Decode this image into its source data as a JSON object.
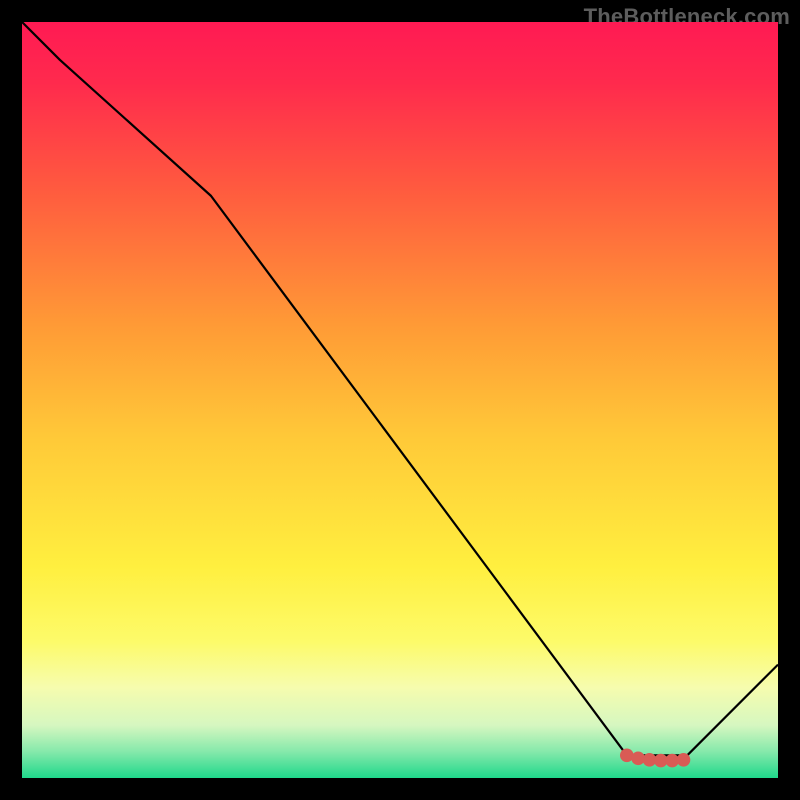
{
  "watermark": "TheBottleneck.com",
  "chart_data": {
    "type": "line",
    "title": "",
    "xlabel": "",
    "ylabel": "",
    "xlim": [
      0,
      100
    ],
    "ylim": [
      0,
      100
    ],
    "grid": false,
    "legend": false,
    "gradient_stops": [
      {
        "offset": 0.0,
        "color": "#ff1a53"
      },
      {
        "offset": 0.08,
        "color": "#ff2a4d"
      },
      {
        "offset": 0.22,
        "color": "#ff5a3f"
      },
      {
        "offset": 0.4,
        "color": "#ff9a36"
      },
      {
        "offset": 0.55,
        "color": "#ffc938"
      },
      {
        "offset": 0.72,
        "color": "#ffef3f"
      },
      {
        "offset": 0.82,
        "color": "#fdfb6a"
      },
      {
        "offset": 0.88,
        "color": "#f6fcae"
      },
      {
        "offset": 0.93,
        "color": "#d6f7c0"
      },
      {
        "offset": 0.965,
        "color": "#86e9ab"
      },
      {
        "offset": 1.0,
        "color": "#1fd88b"
      }
    ],
    "series": [
      {
        "name": "bottleneck-curve",
        "color": "#000000",
        "x": [
          0,
          5,
          25,
          80,
          88,
          100
        ],
        "y": [
          100,
          95,
          77,
          3,
          3,
          15
        ]
      }
    ],
    "markers": {
      "name": "optimal-range",
      "color": "#d95b55",
      "points": [
        {
          "x": 80.0,
          "y": 3.0
        },
        {
          "x": 81.5,
          "y": 2.6
        },
        {
          "x": 83.0,
          "y": 2.4
        },
        {
          "x": 84.5,
          "y": 2.3
        },
        {
          "x": 86.0,
          "y": 2.3
        },
        {
          "x": 87.5,
          "y": 2.4
        }
      ]
    }
  }
}
